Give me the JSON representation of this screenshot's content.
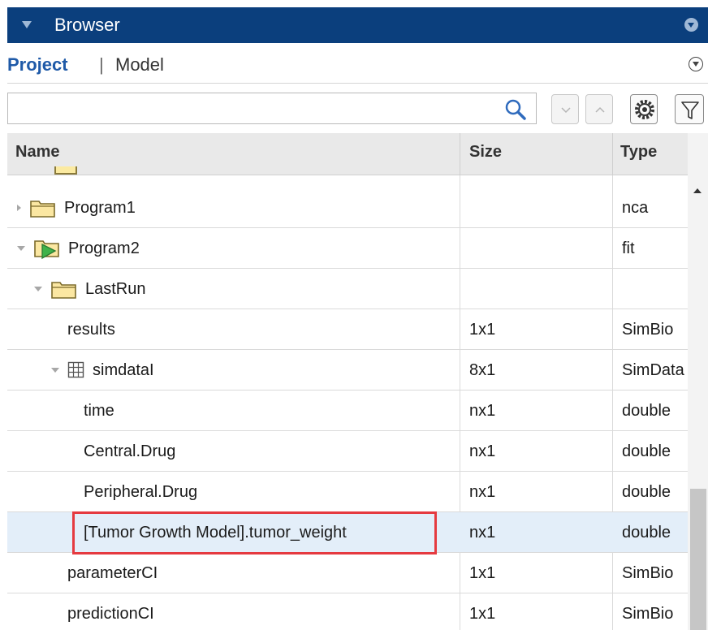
{
  "titlebar": {
    "title": "Browser"
  },
  "tabs": {
    "project": "Project",
    "separator": "|",
    "model": "Model"
  },
  "search": {
    "value": "",
    "placeholder": ""
  },
  "columns": {
    "name": "Name",
    "size": "Size",
    "type": "Type"
  },
  "rows": [
    {
      "name": "Program1",
      "size": "",
      "type": "nca"
    },
    {
      "name": "Program2",
      "size": "",
      "type": "fit"
    },
    {
      "name": "LastRun",
      "size": "",
      "type": ""
    },
    {
      "name": "results",
      "size": "1x1",
      "type": "SimBio"
    },
    {
      "name": "simdataI",
      "size": "8x1",
      "type": "SimData"
    },
    {
      "name": "time",
      "size": "nx1",
      "type": "double"
    },
    {
      "name": "Central.Drug",
      "size": "nx1",
      "type": "double"
    },
    {
      "name": "Peripheral.Drug",
      "size": "nx1",
      "type": "double"
    },
    {
      "name": "[Tumor Growth Model].tumor_weight",
      "size": "nx1",
      "type": "double"
    },
    {
      "name": "parameterCI",
      "size": "1x1",
      "type": "SimBio"
    },
    {
      "name": "predictionCI",
      "size": "1x1",
      "type": "SimBio"
    }
  ],
  "icons": {
    "folder": "folder-icon",
    "program": "program-icon",
    "table": "table-icon",
    "search": "search-icon",
    "gear": "gear-icon",
    "filter": "filter-icon"
  },
  "colors": {
    "titlebar": "#0b3f7d",
    "selected_row": "#e3eef9",
    "highlight": "#e53a40",
    "tab_active": "#1f5aa8"
  }
}
